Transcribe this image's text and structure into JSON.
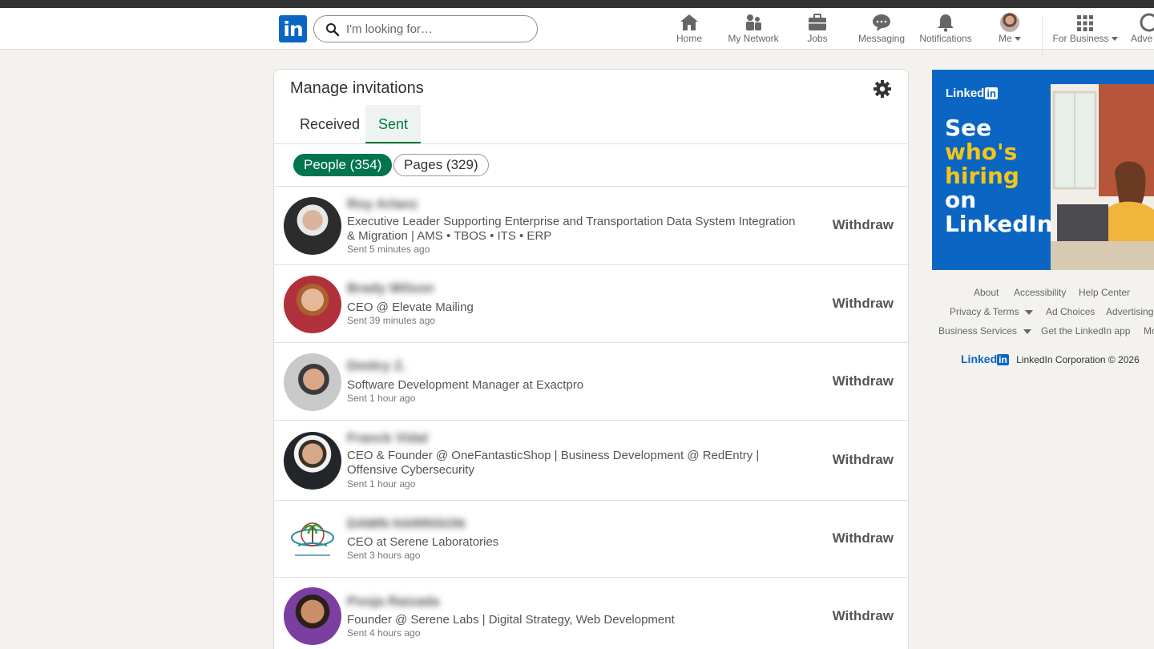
{
  "navbar": {
    "logo": "in",
    "search_placeholder": "I'm looking for…",
    "items": [
      {
        "label": "Home",
        "icon": "home-icon"
      },
      {
        "label": "My Network",
        "icon": "network-icon"
      },
      {
        "label": "Jobs",
        "icon": "briefcase-icon"
      },
      {
        "label": "Messaging",
        "icon": "chat-icon"
      },
      {
        "label": "Notifications",
        "icon": "bell-icon"
      },
      {
        "label": "Me",
        "icon": "avatar"
      },
      {
        "label": "For Business",
        "icon": "grid-icon"
      },
      {
        "label": "Adve",
        "icon": "advertise-icon"
      }
    ]
  },
  "main": {
    "title": "Manage invitations",
    "tabs": [
      {
        "label": "Received"
      },
      {
        "label": "Sent"
      }
    ],
    "active_tab": "Sent",
    "filters": [
      {
        "label": "People (354)"
      },
      {
        "label": "Pages (329)"
      }
    ],
    "invitations": [
      {
        "name": "Roy Arlanz",
        "headline": "Executive Leader Supporting Enterprise and Transportation Data System Integration & Migration | AMS • TBOS • ITS • ERP",
        "sent": "Sent 5 minutes ago",
        "action": "Withdraw"
      },
      {
        "name": "Brady Wilson",
        "headline": "CEO @ Elevate Mailing",
        "sent": "Sent 39 minutes ago",
        "action": "Withdraw"
      },
      {
        "name": "Dmitry Z.",
        "headline": "Software Development Manager at Exactpro",
        "sent": "Sent 1 hour ago",
        "action": "Withdraw"
      },
      {
        "name": "Franck Vidal",
        "headline": "CEO & Founder @ OneFantasticShop | Business Development @ RedEntry | Offensive Cybersecurity",
        "sent": "Sent 1 hour ago",
        "action": "Withdraw"
      },
      {
        "name": "DAWN HARRISON",
        "headline": "CEO at Serene Laboratories",
        "sent": "Sent 3 hours ago",
        "action": "Withdraw"
      },
      {
        "name": "Pooja Raizada",
        "headline": "Founder @ Serene Labs | Digital Strategy, Web Development",
        "sent": "Sent 4 hours ago",
        "action": "Withdraw"
      }
    ]
  },
  "ad": {
    "brand": "Linked",
    "brand_in": "in",
    "line1": "See",
    "line2": "who's",
    "line3": "hiring",
    "line4": "on",
    "line5": "LinkedIn"
  },
  "footer": {
    "links": [
      "About",
      "Accessibility",
      "Help Center",
      "Privacy & Terms",
      "Ad Choices",
      "Advertising",
      "Business Services",
      "Get the LinkedIn app",
      "Mo"
    ],
    "brand": "Linked",
    "brand_in": "in",
    "copyright": "LinkedIn Corporation © 2026"
  },
  "colors": {
    "brand": "#0a66c2",
    "accent_green": "#01754f",
    "ad_yellow": "#f5c518"
  }
}
